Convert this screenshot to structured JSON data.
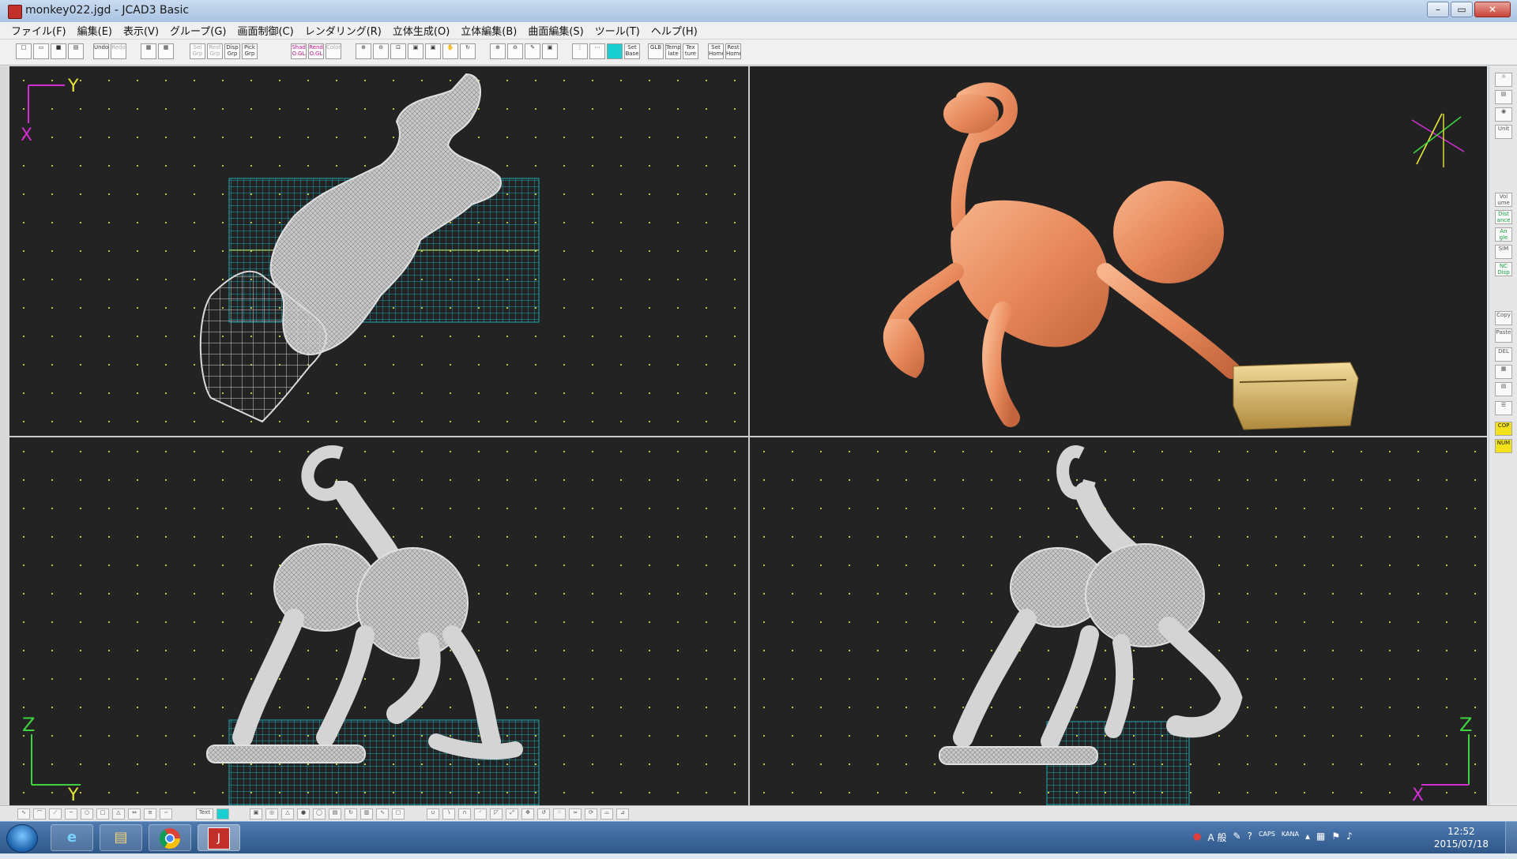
{
  "window": {
    "title": "monkey022.jgd - JCAD3 Basic",
    "buttons": {
      "minimize": "–",
      "maximize": "▭",
      "close": "✕"
    }
  },
  "menu": [
    "ファイル(F)",
    "編集(E)",
    "表示(V)",
    "グループ(G)",
    "画面制御(C)",
    "レンダリング(R)",
    "立体生成(O)",
    "立体編集(B)",
    "曲面編集(S)",
    "ツール(T)",
    "ヘルプ(H)"
  ],
  "toolbar": {
    "undo": "Undo",
    "redo": "Redo",
    "sel_grp": "Sel Grp",
    "rest_grp": "Rest Grp",
    "disp_grp": "Disp Grp",
    "pick_grp": "Pick Grp",
    "shad": "Shad O.GL",
    "rend": "Rend O.GL",
    "color": "Color",
    "set_base": "Set Base",
    "glb": "GLB",
    "templ": "Temp late",
    "texture": "Tex ture",
    "set_home": "Set Home",
    "rest_home": "Rest Home"
  },
  "right_toolbar": {
    "unit": "Unit",
    "vol": "Vol ume",
    "distance": "Dist ance",
    "angle": "An gle",
    "sim": "SIM",
    "nc_disp": "NC Disp",
    "copy": "Copy",
    "paste": "Paste",
    "del": "DEL",
    "cop": "COP",
    "num": "NUM"
  },
  "viewports": {
    "top": {
      "axis_v": "Y",
      "axis_h": "X"
    },
    "front": {
      "axis_v": "Z",
      "axis_h": "Y"
    },
    "side": {
      "axis_v": "Z",
      "axis_h": "X"
    }
  },
  "bottom_toolbar": {
    "text": "Text"
  },
  "taskbar": {
    "ie_label": "e",
    "jcad_label": "J",
    "ime_mode": "A 般",
    "caps": "CAPS",
    "kana": "KANA",
    "time": "12:52",
    "date": "2015/07/18"
  },
  "colors": {
    "viewport_bg": "#232323",
    "grid_dot": "#c8c23b",
    "wireframe": "#d4d4d4",
    "base_grid": "#1fa7b5",
    "render_body": "#f09a6c",
    "render_base": "#d9b76a",
    "axis_magenta": "#d22fd2",
    "axis_yellow": "#e6e63a",
    "axis_green": "#3fd23f"
  },
  "icons": {
    "app": "jcad-icon",
    "new": "new-file-icon",
    "open": "open-folder-icon",
    "save": "save-icon",
    "print": "print-icon",
    "zoom_in": "zoom-in-icon",
    "zoom_out": "zoom-out-icon",
    "pan": "hand-icon",
    "start": "windows-start-icon",
    "explorer": "folder-icon",
    "chrome": "chrome-icon"
  }
}
